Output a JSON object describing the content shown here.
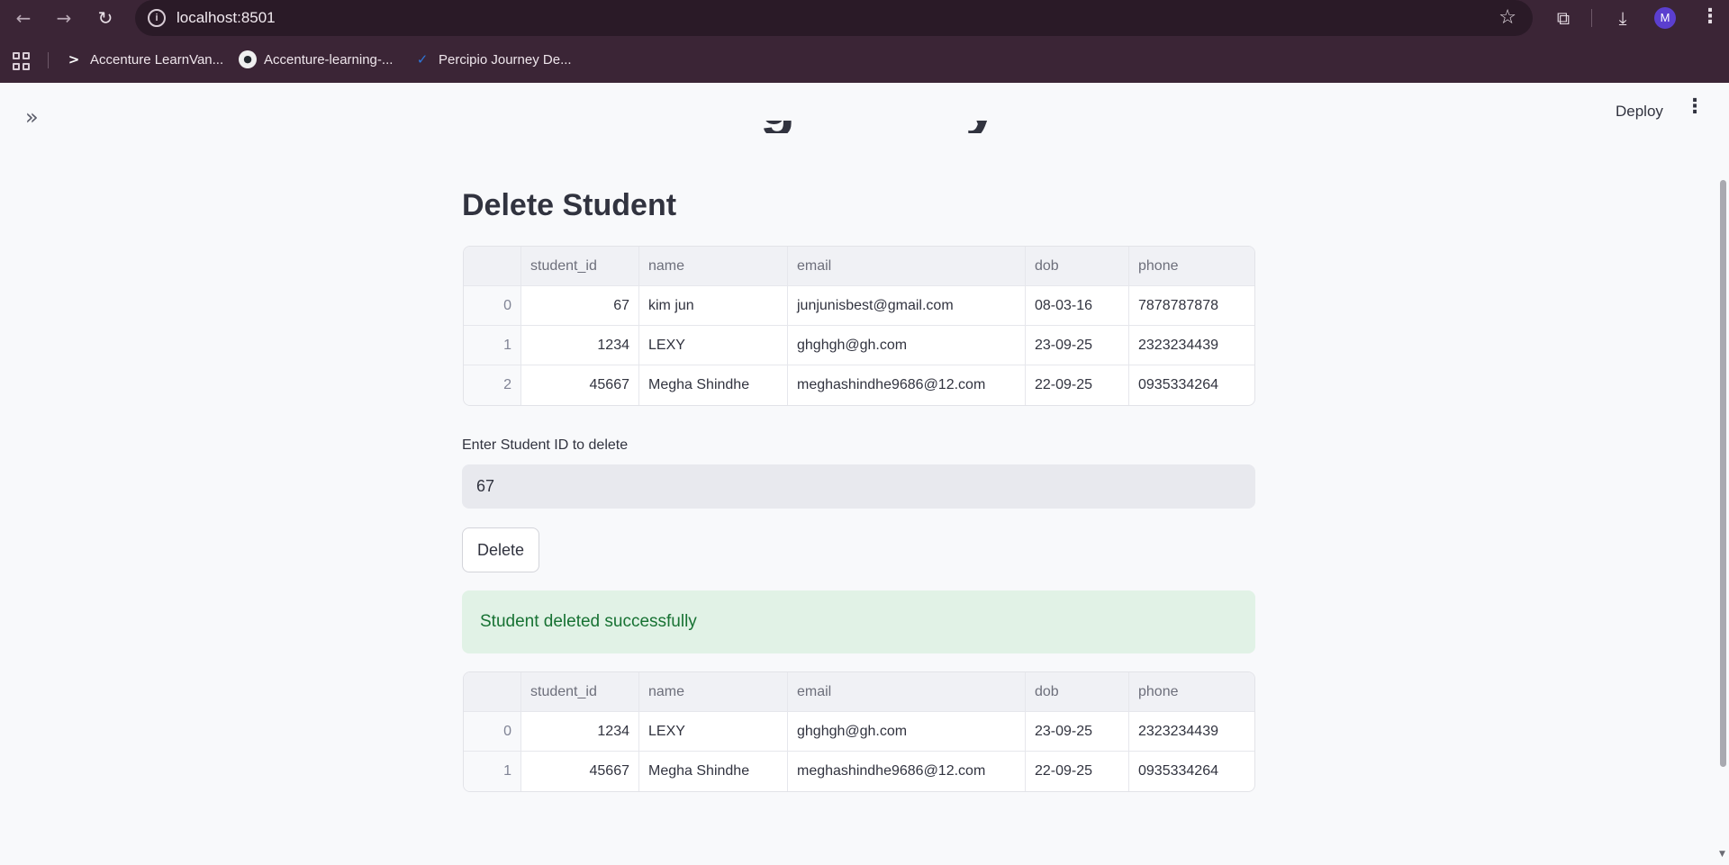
{
  "browser": {
    "url": "localhost:8501",
    "avatar_initial": "M",
    "bookmarks": [
      {
        "label": "Accenture LearnVan...",
        "icon": "accenture-icon"
      },
      {
        "label": "Accenture-learning-...",
        "icon": "github-icon"
      },
      {
        "label": "Percipio Journey De...",
        "icon": "percipio-icon"
      }
    ]
  },
  "header": {
    "deploy_label": "Deploy"
  },
  "section_title": "Delete Student",
  "columns": [
    "",
    "student_id",
    "name",
    "email",
    "dob",
    "phone"
  ],
  "table_before": [
    {
      "idx": "0",
      "student_id": "67",
      "name": "kim jun",
      "email": "junjunisbest@gmail.com",
      "dob": "08-03-16",
      "phone": "7878787878"
    },
    {
      "idx": "1",
      "student_id": "1234",
      "name": "LEXY",
      "email": "ghghgh@gh.com",
      "dob": "23-09-25",
      "phone": "2323234439"
    },
    {
      "idx": "2",
      "student_id": "45667",
      "name": "Megha Shindhe",
      "email": "meghashindhe9686@12.com",
      "dob": "22-09-25",
      "phone": "0935334264"
    }
  ],
  "input": {
    "label": "Enter Student ID to delete",
    "value": "67"
  },
  "delete_button_label": "Delete",
  "success_message": "Student deleted successfully",
  "table_after": [
    {
      "idx": "0",
      "student_id": "1234",
      "name": "LEXY",
      "email": "ghghgh@gh.com",
      "dob": "23-09-25",
      "phone": "2323234439"
    },
    {
      "idx": "1",
      "student_id": "45667",
      "name": "Megha Shindhe",
      "email": "meghashindhe9686@12.com",
      "dob": "22-09-25",
      "phone": "0935334264"
    }
  ],
  "colors": {
    "chrome": "#3b2536",
    "success_bg": "#e1f2e6",
    "success_text": "#177233"
  }
}
